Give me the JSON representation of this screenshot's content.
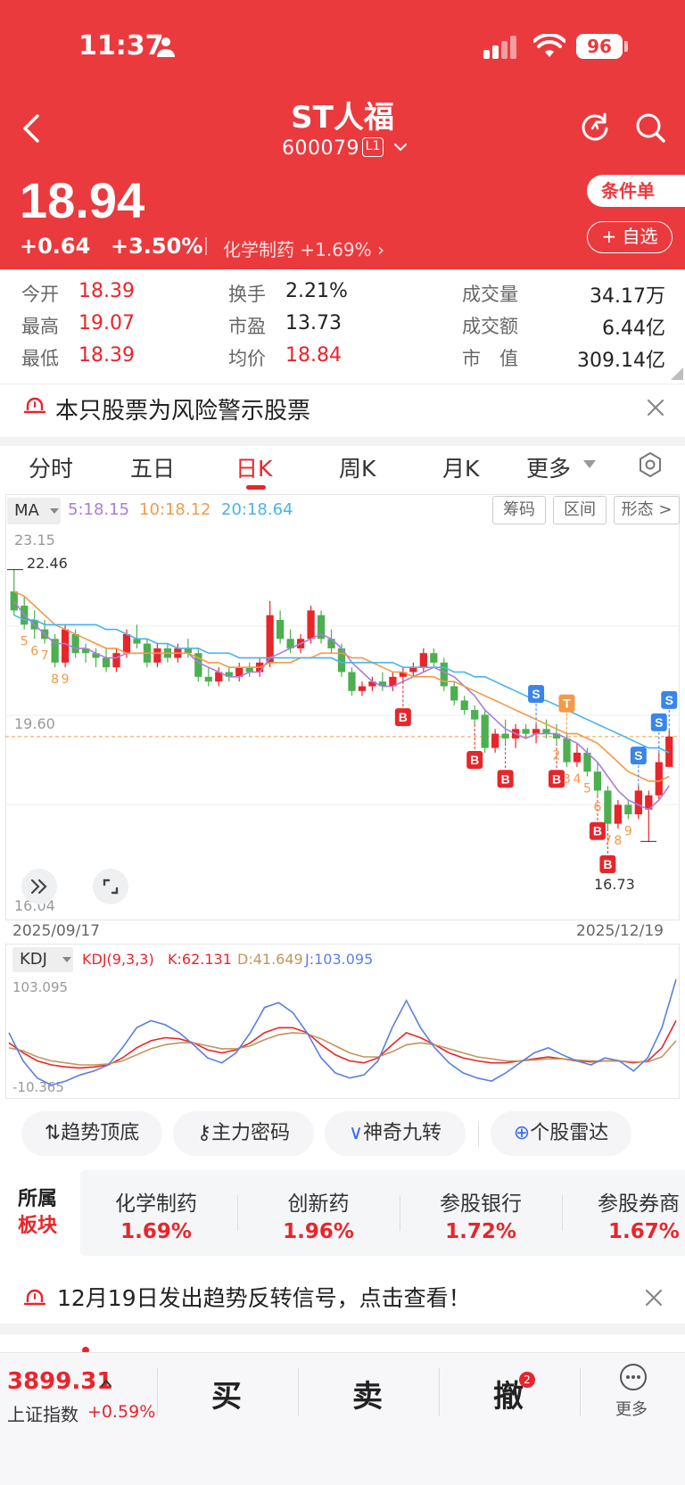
{
  "status_bar": {
    "time": "11:37",
    "battery": "96"
  },
  "header": {
    "stock_name": "ST人福",
    "stock_code": "600079",
    "level_badge": "L1",
    "price": "18.94",
    "change": "+0.64",
    "change_pct": "+3.50%",
    "sector": "化学制药 +1.69%",
    "conditional_order": "条件单",
    "add_favorite": "+ 自选"
  },
  "quote": {
    "open_label": "今开",
    "open": "18.39",
    "high_label": "最高",
    "high": "19.07",
    "low_label": "最低",
    "low": "18.39",
    "turnover_label": "换手",
    "turnover": "2.21%",
    "pe_label": "市盈",
    "pe": "13.73",
    "avg_label": "均价",
    "avg": "18.84",
    "volume_label": "成交量",
    "volume": "34.17万",
    "amount_label": "成交额",
    "amount": "6.44亿",
    "mcap_label": "市　值",
    "mcap": "309.14亿"
  },
  "risk_notice": "本只股票为风险警示股票",
  "period_tabs": [
    "分时",
    "五日",
    "日K",
    "周K",
    "月K",
    "更多"
  ],
  "active_tab": "日K",
  "chart_toolbar": {
    "ma_select": "MA",
    "ma5": "5:18.15",
    "ma10": "10:18.12",
    "ma20": "20:18.64",
    "chips": [
      "筹码",
      "区间",
      "形态 >"
    ]
  },
  "colors": {
    "up": "#e8252b",
    "down": "#4caf50",
    "ma5": "#a97de0",
    "ma10": "#f39a48",
    "ma20": "#4ab3ea",
    "k": "#e8252b",
    "d": "#c2955a",
    "j": "#5b7fe0",
    "brand": "#ea3a3e"
  },
  "chart_data": [
    {
      "type": "candlestick",
      "y_axis_labels": [
        "23.15",
        "19.60",
        "16.04"
      ],
      "ylim": [
        16.04,
        23.15
      ],
      "max_marker": "22.46",
      "min_marker": "16.73",
      "x_start": "2025/09/17",
      "x_end": "2025/12/19",
      "last_close_line": 18.94,
      "candles": [
        {
          "o": 22.0,
          "h": 22.46,
          "l": 21.5,
          "c": 21.6
        },
        {
          "o": 21.7,
          "h": 21.9,
          "l": 21.2,
          "c": 21.3
        },
        {
          "o": 21.4,
          "h": 21.6,
          "l": 21.0,
          "c": 21.2
        },
        {
          "o": 21.2,
          "h": 21.4,
          "l": 20.9,
          "c": 21.0
        },
        {
          "o": 21.0,
          "h": 21.1,
          "l": 20.4,
          "c": 20.5
        },
        {
          "o": 20.5,
          "h": 21.3,
          "l": 20.4,
          "c": 21.2
        },
        {
          "o": 21.1,
          "h": 21.2,
          "l": 20.6,
          "c": 20.7
        },
        {
          "o": 20.8,
          "h": 20.9,
          "l": 20.5,
          "c": 20.7
        },
        {
          "o": 20.7,
          "h": 20.8,
          "l": 20.4,
          "c": 20.6
        },
        {
          "o": 20.6,
          "h": 20.8,
          "l": 20.3,
          "c": 20.4
        },
        {
          "o": 20.4,
          "h": 20.8,
          "l": 20.3,
          "c": 20.7
        },
        {
          "o": 20.7,
          "h": 21.2,
          "l": 20.6,
          "c": 21.1
        },
        {
          "o": 21.0,
          "h": 21.3,
          "l": 20.8,
          "c": 20.9
        },
        {
          "o": 20.9,
          "h": 21.0,
          "l": 20.4,
          "c": 20.5
        },
        {
          "o": 20.5,
          "h": 20.9,
          "l": 20.4,
          "c": 20.8
        },
        {
          "o": 20.8,
          "h": 20.9,
          "l": 20.5,
          "c": 20.6
        },
        {
          "o": 20.6,
          "h": 20.9,
          "l": 20.5,
          "c": 20.8
        },
        {
          "o": 20.8,
          "h": 21.0,
          "l": 20.6,
          "c": 20.7
        },
        {
          "o": 20.7,
          "h": 20.8,
          "l": 20.1,
          "c": 20.2
        },
        {
          "o": 20.2,
          "h": 20.4,
          "l": 20.0,
          "c": 20.1
        },
        {
          "o": 20.1,
          "h": 20.4,
          "l": 20.0,
          "c": 20.3
        },
        {
          "o": 20.3,
          "h": 20.4,
          "l": 20.1,
          "c": 20.2
        },
        {
          "o": 20.2,
          "h": 20.5,
          "l": 20.1,
          "c": 20.4
        },
        {
          "o": 20.4,
          "h": 20.5,
          "l": 20.2,
          "c": 20.3
        },
        {
          "o": 20.3,
          "h": 20.6,
          "l": 20.2,
          "c": 20.5
        },
        {
          "o": 20.5,
          "h": 21.8,
          "l": 20.4,
          "c": 21.5
        },
        {
          "o": 21.4,
          "h": 21.6,
          "l": 20.9,
          "c": 21.0
        },
        {
          "o": 21.0,
          "h": 21.2,
          "l": 20.7,
          "c": 20.8
        },
        {
          "o": 20.8,
          "h": 21.1,
          "l": 20.7,
          "c": 21.0
        },
        {
          "o": 21.0,
          "h": 21.7,
          "l": 20.9,
          "c": 21.6
        },
        {
          "o": 21.5,
          "h": 21.6,
          "l": 20.9,
          "c": 21.0
        },
        {
          "o": 21.0,
          "h": 21.2,
          "l": 20.7,
          "c": 20.8
        },
        {
          "o": 20.8,
          "h": 20.9,
          "l": 20.2,
          "c": 20.3
        },
        {
          "o": 20.3,
          "h": 20.4,
          "l": 19.8,
          "c": 19.9
        },
        {
          "o": 19.9,
          "h": 20.1,
          "l": 19.8,
          "c": 20.0
        },
        {
          "o": 20.0,
          "h": 20.2,
          "l": 19.9,
          "c": 20.1
        },
        {
          "o": 20.1,
          "h": 20.3,
          "l": 19.9,
          "c": 20.0
        },
        {
          "o": 20.0,
          "h": 20.3,
          "l": 19.9,
          "c": 20.2
        },
        {
          "o": 20.2,
          "h": 20.4,
          "l": 20.1,
          "c": 20.3
        },
        {
          "o": 20.3,
          "h": 20.5,
          "l": 20.2,
          "c": 20.4
        },
        {
          "o": 20.4,
          "h": 20.8,
          "l": 20.3,
          "c": 20.7
        },
        {
          "o": 20.7,
          "h": 20.8,
          "l": 20.4,
          "c": 20.5
        },
        {
          "o": 20.5,
          "h": 20.6,
          "l": 19.9,
          "c": 20.0
        },
        {
          "o": 20.0,
          "h": 20.1,
          "l": 19.6,
          "c": 19.7
        },
        {
          "o": 19.7,
          "h": 19.8,
          "l": 19.4,
          "c": 19.5
        },
        {
          "o": 19.5,
          "h": 19.6,
          "l": 19.2,
          "c": 19.3
        },
        {
          "o": 19.4,
          "h": 19.5,
          "l": 18.6,
          "c": 18.7
        },
        {
          "o": 18.7,
          "h": 19.1,
          "l": 18.6,
          "c": 19.0
        },
        {
          "o": 19.0,
          "h": 19.3,
          "l": 18.8,
          "c": 18.9
        },
        {
          "o": 18.9,
          "h": 19.2,
          "l": 18.7,
          "c": 19.1
        },
        {
          "o": 19.1,
          "h": 19.2,
          "l": 18.9,
          "c": 19.0
        },
        {
          "o": 19.0,
          "h": 19.2,
          "l": 18.8,
          "c": 19.1
        },
        {
          "o": 19.1,
          "h": 19.3,
          "l": 18.9,
          "c": 19.0
        },
        {
          "o": 19.0,
          "h": 19.2,
          "l": 18.8,
          "c": 18.9
        },
        {
          "o": 18.9,
          "h": 19.0,
          "l": 18.3,
          "c": 18.4
        },
        {
          "o": 18.4,
          "h": 18.8,
          "l": 18.3,
          "c": 18.6
        },
        {
          "o": 18.6,
          "h": 18.7,
          "l": 18.1,
          "c": 18.2
        },
        {
          "o": 18.2,
          "h": 18.4,
          "l": 17.7,
          "c": 17.8
        },
        {
          "o": 17.8,
          "h": 17.9,
          "l": 17.0,
          "c": 17.1
        },
        {
          "o": 17.1,
          "h": 17.6,
          "l": 17.0,
          "c": 17.5
        },
        {
          "o": 17.5,
          "h": 17.6,
          "l": 17.2,
          "c": 17.3
        },
        {
          "o": 17.3,
          "h": 17.9,
          "l": 17.2,
          "c": 17.8
        },
        {
          "o": 17.4,
          "h": 17.8,
          "l": 16.73,
          "c": 17.7
        },
        {
          "o": 17.7,
          "h": 18.6,
          "l": 17.6,
          "c": 18.4
        },
        {
          "o": 18.3,
          "h": 19.07,
          "l": 18.3,
          "c": 18.94
        }
      ],
      "ma5": [
        21.8,
        21.5,
        21.3,
        21.1,
        20.9,
        20.9,
        20.8,
        20.8,
        20.7,
        20.6,
        20.6,
        20.7,
        20.7,
        20.7,
        20.7,
        20.7,
        20.7,
        20.7,
        20.5,
        20.4,
        20.3,
        20.2,
        20.2,
        20.3,
        20.3,
        20.6,
        20.7,
        20.8,
        20.9,
        21.0,
        21.1,
        21.0,
        20.8,
        20.5,
        20.3,
        20.1,
        20.0,
        20.0,
        20.1,
        20.2,
        20.3,
        20.4,
        20.3,
        20.2,
        20.0,
        19.8,
        19.5,
        19.3,
        19.1,
        19.0,
        18.9,
        19.0,
        19.0,
        19.0,
        18.9,
        18.8,
        18.6,
        18.4,
        18.1,
        17.8,
        17.6,
        17.5,
        17.4,
        17.6,
        17.9
      ],
      "ma10": [
        22.0,
        21.9,
        21.7,
        21.5,
        21.3,
        21.2,
        21.1,
        21.0,
        20.9,
        20.8,
        20.8,
        20.7,
        20.7,
        20.7,
        20.7,
        20.7,
        20.7,
        20.7,
        20.6,
        20.5,
        20.5,
        20.4,
        20.4,
        20.4,
        20.4,
        20.5,
        20.5,
        20.5,
        20.6,
        20.6,
        20.7,
        20.7,
        20.7,
        20.6,
        20.6,
        20.5,
        20.4,
        20.3,
        20.3,
        20.2,
        20.2,
        20.2,
        20.1,
        20.1,
        20.0,
        19.9,
        19.8,
        19.7,
        19.6,
        19.5,
        19.4,
        19.3,
        19.2,
        19.1,
        19.0,
        19.0,
        18.9,
        18.8,
        18.6,
        18.4,
        18.2,
        18.1,
        18.0,
        18.0,
        18.1
      ],
      "ma20": [
        21.5,
        21.4,
        21.4,
        21.3,
        21.3,
        21.3,
        21.3,
        21.3,
        21.3,
        21.2,
        21.2,
        21.1,
        21.0,
        21.0,
        20.9,
        20.9,
        20.8,
        20.8,
        20.8,
        20.7,
        20.7,
        20.7,
        20.6,
        20.6,
        20.6,
        20.6,
        20.6,
        20.6,
        20.6,
        20.6,
        20.6,
        20.6,
        20.5,
        20.5,
        20.5,
        20.5,
        20.5,
        20.5,
        20.4,
        20.4,
        20.4,
        20.4,
        20.4,
        20.3,
        20.3,
        20.2,
        20.2,
        20.1,
        20.0,
        19.9,
        19.8,
        19.7,
        19.7,
        19.6,
        19.5,
        19.4,
        19.3,
        19.2,
        19.1,
        19.0,
        18.9,
        18.8,
        18.7,
        18.7,
        18.6
      ],
      "signals": [
        {
          "label": "B",
          "i": 38
        },
        {
          "label": "B",
          "i": 45
        },
        {
          "label": "B",
          "i": 48
        },
        {
          "label": "B",
          "i": 53
        },
        {
          "label": "B",
          "i": 57
        },
        {
          "label": "B",
          "i": 58
        },
        {
          "label": "S",
          "i": 51
        },
        {
          "label": "T",
          "i": 54
        },
        {
          "label": "S",
          "i": 61
        },
        {
          "label": "S",
          "i": 63
        },
        {
          "label": "S",
          "i": 64
        }
      ],
      "counts": [
        {
          "t": "5",
          "i": 1
        },
        {
          "t": "6",
          "i": 2
        },
        {
          "t": "7",
          "i": 3
        },
        {
          "t": "8",
          "i": 4
        },
        {
          "t": "9",
          "i": 5
        },
        {
          "t": "2",
          "i": 53
        },
        {
          "t": "3",
          "i": 54
        },
        {
          "t": "4",
          "i": 55
        },
        {
          "t": "5",
          "i": 56
        },
        {
          "t": "6",
          "i": 57
        },
        {
          "t": "7",
          "i": 58
        },
        {
          "t": "8",
          "i": 59
        },
        {
          "t": "9",
          "i": 60
        }
      ]
    },
    {
      "type": "line",
      "title": "KDJ(9,3,3)",
      "k_label": "K:62.131",
      "d_label": "D:41.649",
      "j_label": "J:103.095",
      "y_top": "103.095",
      "y_bottom": "-10.365",
      "ylim": [
        -10.365,
        103.095
      ],
      "series": [
        {
          "name": "K",
          "values": [
            40,
            30,
            22,
            18,
            16,
            15,
            16,
            18,
            25,
            35,
            42,
            45,
            44,
            40,
            33,
            30,
            33,
            40,
            50,
            55,
            55,
            50,
            38,
            28,
            22,
            20,
            25,
            38,
            50,
            45,
            38,
            30,
            25,
            22,
            20,
            20,
            22,
            24,
            26,
            24,
            22,
            21,
            22,
            22,
            20,
            22,
            35,
            62
          ]
        },
        {
          "name": "D",
          "values": [
            35,
            32,
            26,
            22,
            20,
            18,
            18,
            19,
            22,
            28,
            34,
            38,
            40,
            40,
            37,
            34,
            34,
            37,
            43,
            48,
            50,
            49,
            44,
            37,
            30,
            26,
            26,
            31,
            38,
            40,
            38,
            34,
            30,
            26,
            24,
            22,
            22,
            23,
            24,
            24,
            23,
            22,
            22,
            22,
            21,
            21,
            26,
            42
          ]
        },
        {
          "name": "J",
          "values": [
            50,
            22,
            5,
            -2,
            2,
            8,
            12,
            18,
            35,
            55,
            62,
            58,
            50,
            38,
            25,
            20,
            30,
            50,
            75,
            80,
            70,
            50,
            25,
            10,
            5,
            8,
            22,
            55,
            82,
            55,
            35,
            20,
            10,
            5,
            2,
            10,
            20,
            30,
            35,
            28,
            22,
            18,
            25,
            22,
            12,
            25,
            55,
            103
          ]
        }
      ]
    }
  ],
  "chart_labels": {
    "y_top": "23.15",
    "y_mid": "19.60",
    "y_bottom": "16.04",
    "max": "22.46",
    "min": "16.73",
    "date_start": "2025/09/17",
    "date_end": "2025/12/19",
    "kdj_select": "KDJ",
    "kdj_title": "KDJ(9,3,3)",
    "kdj_k": "K:62.131",
    "kdj_d": "D:41.649",
    "kdj_j": "J:103.095",
    "kdj_top": "103.095",
    "kdj_bottom": "-10.365"
  },
  "tools": [
    "趋势顶底",
    "主力密码",
    "神奇九转",
    "个股雷达"
  ],
  "sectors": {
    "label_line1": "所属",
    "label_line2": "板块",
    "items": [
      {
        "name": "化学制药",
        "value": "1.69%"
      },
      {
        "name": "创新药",
        "value": "1.96%"
      },
      {
        "name": "参股银行",
        "value": "1.72%"
      },
      {
        "name": "参股券商",
        "value": "1.67%"
      }
    ]
  },
  "signal_notice": "12月19日发出趋势反转信号，点击查看！",
  "bottom_bar": {
    "index_value": "3899.31",
    "index_name": "上证指数",
    "index_pct": "+0.59%",
    "buy": "买",
    "sell": "卖",
    "cancel": "撤",
    "cancel_badge": "2",
    "more": "更多"
  }
}
